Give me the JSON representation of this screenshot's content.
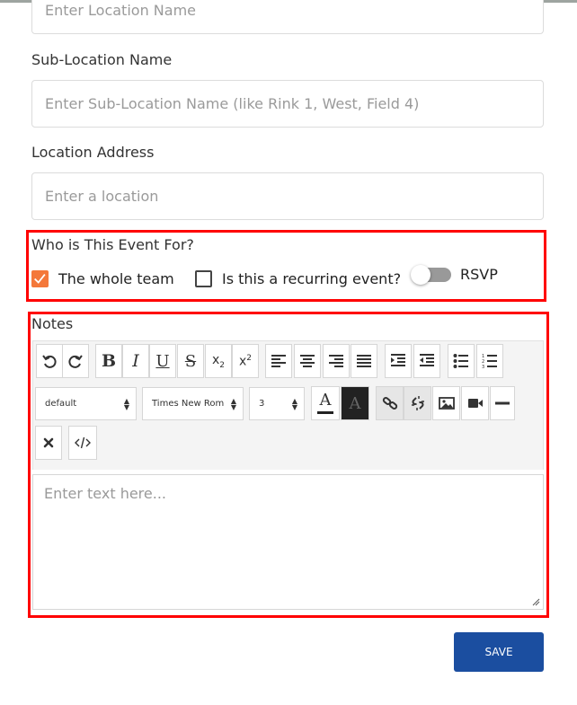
{
  "form": {
    "location_name": {
      "placeholder": "Enter Location Name"
    },
    "sub_location": {
      "label": "Sub-Location Name",
      "placeholder": "Enter Sub-Location Name (like Rink 1, West, Field 4)"
    },
    "location_address": {
      "label": "Location Address",
      "placeholder": "Enter a location"
    }
  },
  "audience": {
    "title": "Who is This Event For?",
    "whole_team": {
      "label": "The whole team",
      "checked": true
    },
    "recurring": {
      "label": "Is this a recurring event?",
      "checked": false
    },
    "rsvp": {
      "label": "RSVP",
      "on": false
    }
  },
  "notes": {
    "title": "Notes",
    "toolbar": {
      "font_size_select": "default",
      "font_family_select": "Times New Roman",
      "size_select": "3",
      "buttons": [
        "undo-icon",
        "redo-icon",
        "bold-icon",
        "italic-icon",
        "underline-icon",
        "strikethrough-icon",
        "subscript-icon",
        "superscript-icon",
        "align-left-icon",
        "align-center-icon",
        "align-right-icon",
        "justify-icon",
        "indent-icon",
        "outdent-icon",
        "bullet-list-icon",
        "numbered-list-icon",
        "font-color-icon",
        "highlight-color-icon",
        "link-icon",
        "unlink-icon",
        "image-icon",
        "video-icon",
        "horizontal-rule-icon",
        "remove-format-icon",
        "source-code-icon"
      ],
      "glyphs": {
        "bold": "B",
        "italic": "I",
        "underline": "U",
        "strike": "S",
        "sub": "x",
        "sub_script": "2",
        "sup": "x",
        "sup_script": "2",
        "font_color": "A",
        "highlight": "A"
      }
    },
    "editor_placeholder": "Enter text here..."
  },
  "actions": {
    "save_label": "SAVE"
  },
  "colors": {
    "accent_orange": "#f4783a",
    "save_blue": "#1b4ea0",
    "highlight_red": "#ff0000"
  }
}
